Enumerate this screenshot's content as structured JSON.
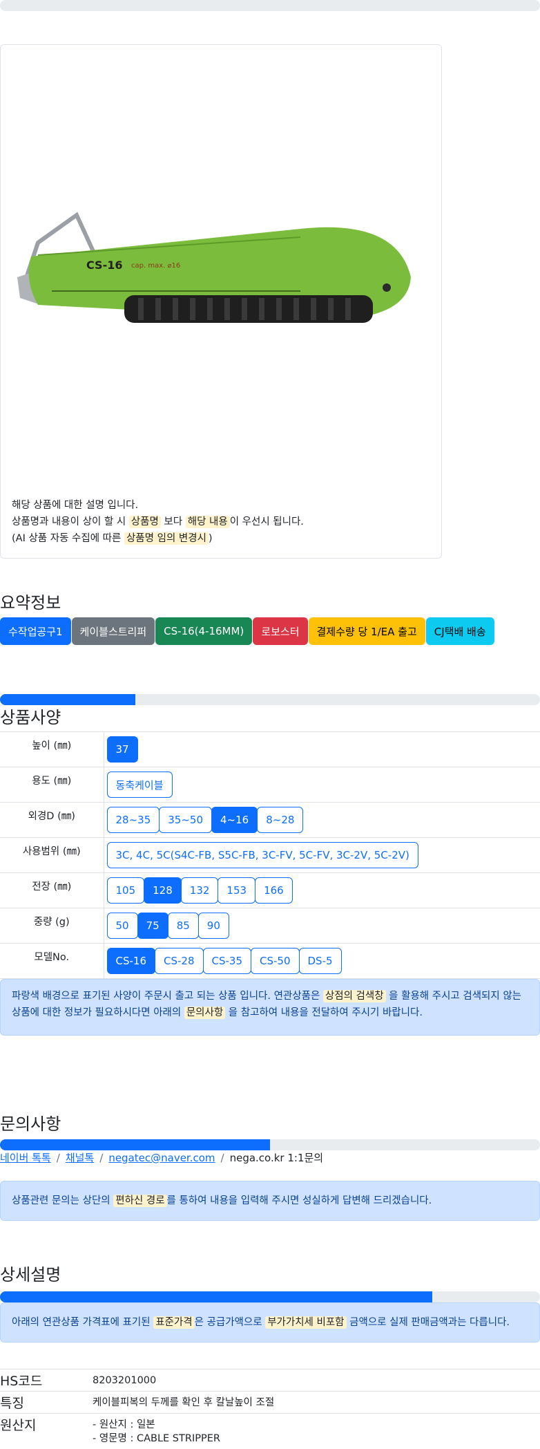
{
  "card": {
    "line1": "해당 상품에 대한 설명 입니다.",
    "line2_a": "상품명과 내용이 상이 할 시 ",
    "line2_hl1": "상품명",
    "line2_b": " 보다 ",
    "line2_hl2": "해당 내용",
    "line2_c": "이 우선시 됩니다.",
    "line3_a": "(AI 상품 자동 수집에 따른 ",
    "line3_hl": "상품명 임의 변경시",
    "line3_b": ")",
    "product_label": "CS-16",
    "product_cap": "cap. max. ⌀16"
  },
  "summary": {
    "title": "요약정보",
    "badges": [
      {
        "label": "수작업공구1",
        "color": "#0d6efd"
      },
      {
        "label": "케이블스트리퍼",
        "color": "#6c757d"
      },
      {
        "label": "CS-16(4-16MM)",
        "color": "#198754"
      },
      {
        "label": "로보스터",
        "color": "#dc3545"
      },
      {
        "label": "결제수량 당 1/EA 출고",
        "color": "#ffc107"
      },
      {
        "label": "CJ택배 배송",
        "color": "#0dcaf0"
      }
    ]
  },
  "spec": {
    "title": "상품사양",
    "progress": 0.25,
    "rows": [
      {
        "label": "높이 (㎜)",
        "options": [
          "37"
        ],
        "active": 0
      },
      {
        "label": "용도 (㎜)",
        "options": [
          "동축케이블"
        ],
        "active": -1
      },
      {
        "label": "외경D (㎜)",
        "options": [
          "28~35",
          "35~50",
          "4~16",
          "8~28"
        ],
        "active": 2
      },
      {
        "label": "사용범위 (㎜)",
        "options": [
          "3C, 4C, 5C(S4C-FB, S5C-FB, 3C-FV, 5C-FV, 3C-2V, 5C-2V)"
        ],
        "active": -1
      },
      {
        "label": "전장 (㎜)",
        "options": [
          "105",
          "128",
          "132",
          "153",
          "166"
        ],
        "active": 1
      },
      {
        "label": "중량 (g)",
        "options": [
          "50",
          "75",
          "85",
          "90"
        ],
        "active": 1
      },
      {
        "label": "모델No.",
        "options": [
          "CS-16",
          "CS-28",
          "CS-35",
          "CS-50",
          "DS-5"
        ],
        "active": 0
      }
    ],
    "notice_a": "파랑색 배경으로 표기된 사양이 주문시 출고 되는 상품 입니다. 연관상품은 ",
    "notice_hl1": "상점의 검색창",
    "notice_b": " 을 활용해 주시고 검색되지 않는 상품에 대한 정보가 필요하시다면 아래의 ",
    "notice_hl2": "문의사항",
    "notice_c": " 을 참고하여 내용을 전달하여 주시기 바랍니다."
  },
  "inquiry": {
    "title": "문의사항",
    "progress": 0.5,
    "links": [
      "네이버 톡톡",
      "채널톡",
      "negatec@naver.com"
    ],
    "plain": "nega.co.kr 1:1문의",
    "separator": "/",
    "notice_a": "상품관련 문의는 상단의 ",
    "notice_hl": "편하신 경로",
    "notice_b": "를 통하여 내용을 입력해 주시면 성실하게 답변해 드리겠습니다."
  },
  "detail": {
    "title": "상세설명",
    "progress": 0.8,
    "notice_a": "아래의 연관상품 가격표에 표기된 ",
    "notice_hl1": "표준가격",
    "notice_b": "은 공급가액으로 ",
    "notice_hl2": "부가가치세 비포함",
    "notice_c": " 금액으로 실제 판매금액과는 다릅니다.",
    "rows": [
      {
        "key": "HS코드",
        "value": "8203201000"
      },
      {
        "key": "특징",
        "value": "케이블피복의 두께를 확인 후 칼날높이 조절"
      },
      {
        "key": "원산지",
        "value": "- 원산지 : 일본",
        "value2": "- 영문명 : CABLE STRIPPER"
      }
    ]
  },
  "colors": {
    "primary": "#0d6efd",
    "alert_bg": "#cfe2ff",
    "highlight": "#fff3cd",
    "tool_green": "#7cbc3c"
  }
}
